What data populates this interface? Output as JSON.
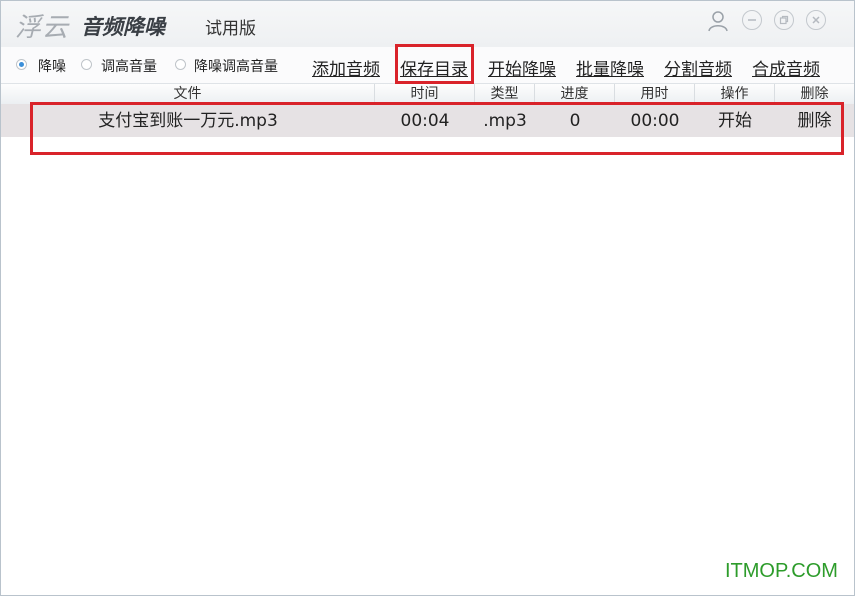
{
  "app": {
    "logo_left": "浮云",
    "logo_right": "音频降噪",
    "edition": "试用版"
  },
  "window_controls": {
    "user": "user-icon",
    "minimize": "minimize-icon",
    "restore": "restore-icon",
    "close": "close-icon"
  },
  "modes": [
    {
      "label": "降噪",
      "selected": true
    },
    {
      "label": "调高音量",
      "selected": false
    },
    {
      "label": "降噪调高音量",
      "selected": false
    }
  ],
  "toolbar": {
    "add_audio": "添加音频",
    "save_dir": "保存目录",
    "start_denoise": "开始降噪",
    "batch_denoise": "批量降噪",
    "split_audio": "分割音频",
    "merge_audio": "合成音频"
  },
  "table": {
    "columns": [
      "文件",
      "时间",
      "类型",
      "进度",
      "用时",
      "操作",
      "删除"
    ],
    "rows": [
      {
        "file": "支付宝到账一万元.mp3",
        "duration": "00:04",
        "type": ".mp3",
        "progress": "0",
        "elapsed": "00:00",
        "action": "开始",
        "delete": "删除"
      }
    ]
  },
  "highlight_color": "#d9232a",
  "watermark": "ITMOP.COM"
}
